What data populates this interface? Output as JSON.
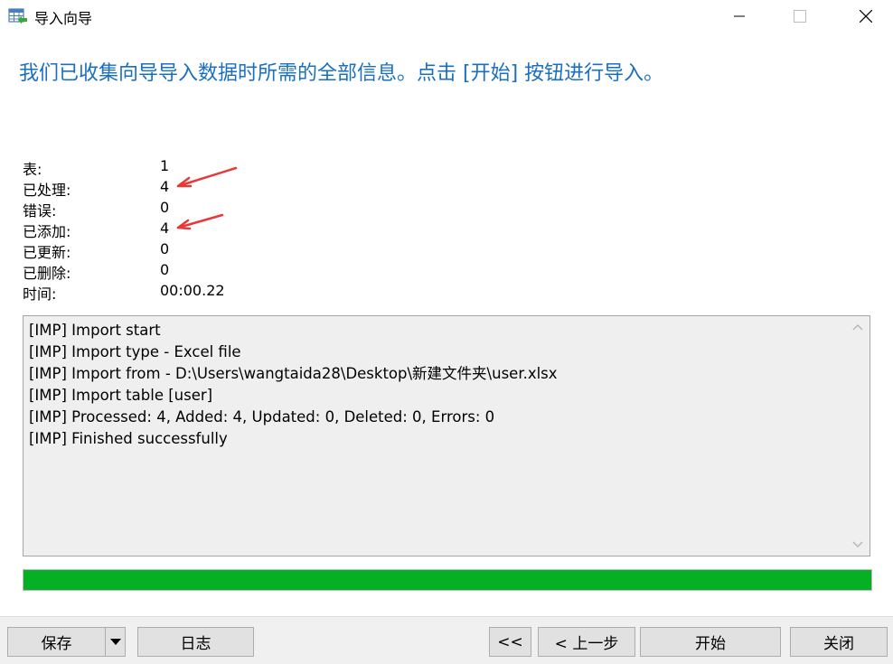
{
  "window": {
    "title": "导入向导",
    "icon": "table-import-icon"
  },
  "headline": "我们已收集向导导入数据时所需的全部信息。点击 [开始] 按钮进行导入。",
  "stats": [
    {
      "label": "表:",
      "value": "1"
    },
    {
      "label": "已处理:",
      "value": "4"
    },
    {
      "label": "错误:",
      "value": "0"
    },
    {
      "label": "已添加:",
      "value": "4"
    },
    {
      "label": "已更新:",
      "value": "0"
    },
    {
      "label": "已删除:",
      "value": "0"
    },
    {
      "label": "时间:",
      "value": "00:00.22"
    }
  ],
  "log": [
    "[IMP] Import start",
    "[IMP] Import type - Excel file",
    "[IMP] Import from - D:\\Users\\wangtaida28\\Desktop\\新建文件夹\\user.xlsx",
    "[IMP] Import table [user]",
    "[IMP] Processed: 4, Added: 4, Updated: 0, Deleted: 0, Errors: 0",
    "[IMP] Finished successfully"
  ],
  "progress": {
    "percent": 100,
    "color": "#06b025"
  },
  "buttons": {
    "save": "保存",
    "log": "日志",
    "first": "<<",
    "prev": "< 上一步",
    "start": "开始",
    "close": "关闭"
  },
  "colors": {
    "headline": "#1a6fc0",
    "annotation_arrow": "#e8383a"
  }
}
